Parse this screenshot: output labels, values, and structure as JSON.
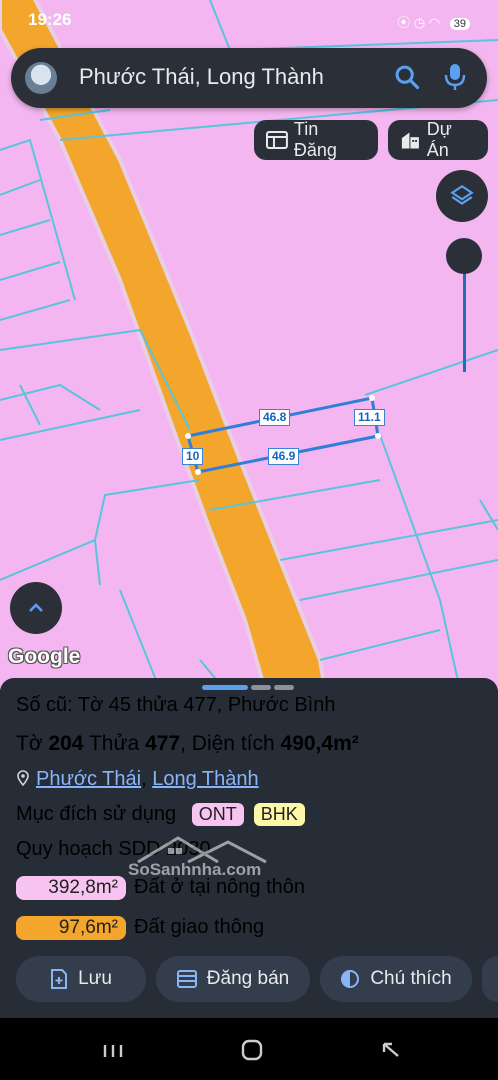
{
  "status_bar": {
    "time": "19:26",
    "battery": "39"
  },
  "search": {
    "title": "Phước Thái, Long Thành"
  },
  "chips": {
    "listing": "Tin Đăng",
    "project": "Dự Án"
  },
  "map": {
    "measurements": {
      "top": "46.8",
      "bottom": "46.9",
      "left": "10",
      "right": "11.1"
    },
    "attribution": "Google"
  },
  "sheet": {
    "old_parcel": "Số cũ: Tờ 45 thửa 477, Phước Bình",
    "parcel": {
      "to_label": "Tờ",
      "to_value": "204",
      "thua_label": "Thửa",
      "thua_value": "477",
      "area_label": "Diện tích",
      "area_value": "490,4m²"
    },
    "location": {
      "ward": "Phước Thái",
      "separator": ", ",
      "district": "Long Thành"
    },
    "usage": {
      "label": "Mục đích sử dụng",
      "codes": [
        "ONT",
        "BHK"
      ]
    },
    "planning": {
      "label": "Quy hoạch SDD 2030"
    },
    "zones": [
      {
        "area": "392,8m²",
        "label": "Đất ở tại nông thôn",
        "color": "#f7c4f2"
      },
      {
        "area": "97,6m²",
        "label": "Đất giao thông",
        "color": "#f4a52b"
      }
    ],
    "actions": {
      "save": "Lưu",
      "sell": "Đăng bán",
      "legend": "Chú thích"
    }
  },
  "watermark": "SoSanhnha.com",
  "colors": {
    "land": "#f4b6f0",
    "road": "#f4a52b",
    "panel": "#262d37",
    "accent": "#8ab4f8"
  }
}
